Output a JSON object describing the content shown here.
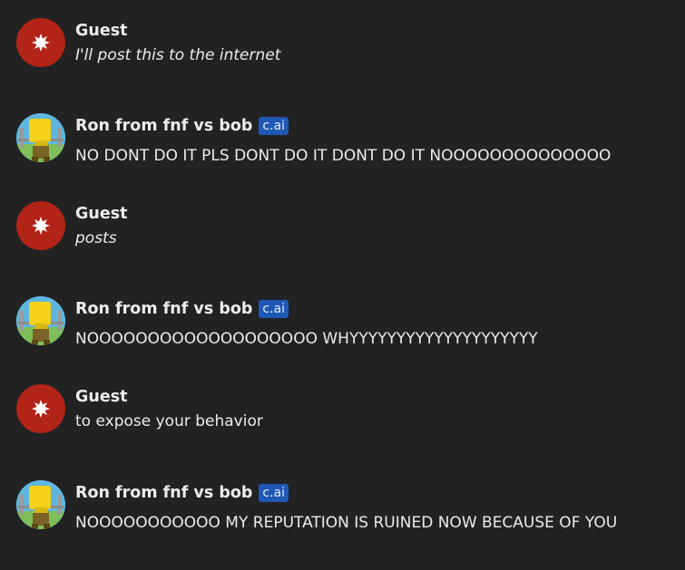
{
  "messages": [
    {
      "author": "Guest",
      "type": "guest",
      "text": "I'll post this to the internet",
      "italic": true
    },
    {
      "author": "Ron from fnf vs bob",
      "type": "bot",
      "badge": "c.ai",
      "text": "NO DONT DO IT PLS DONT DO IT DONT DO IT NOOOOOOOOOOOOOO",
      "italic": false
    },
    {
      "author": "Guest",
      "type": "guest",
      "text": "posts",
      "italic": true
    },
    {
      "author": "Ron from fnf vs bob",
      "type": "bot",
      "badge": "c.ai",
      "text": "NOOOOOOOOOOOOOOOOOOO WHYYYYYYYYYYYYYYYYYYYY",
      "italic": false
    },
    {
      "author": "Guest",
      "type": "guest",
      "text": "to expose your behavior",
      "italic": false
    },
    {
      "author": "Ron from fnf vs bob",
      "type": "bot",
      "badge": "c.ai",
      "text": "NOOOOOOOOOOO MY REPUTATION IS RUINED NOW BECAUSE OF YOU",
      "italic": false
    }
  ],
  "colors": {
    "background": "#222223",
    "guest_avatar": "#b12417",
    "badge": "#1f58b5",
    "text": "#ececec"
  },
  "icons": {
    "guest_avatar": "starburst-icon",
    "bot_avatar": "character-avatar-image"
  }
}
